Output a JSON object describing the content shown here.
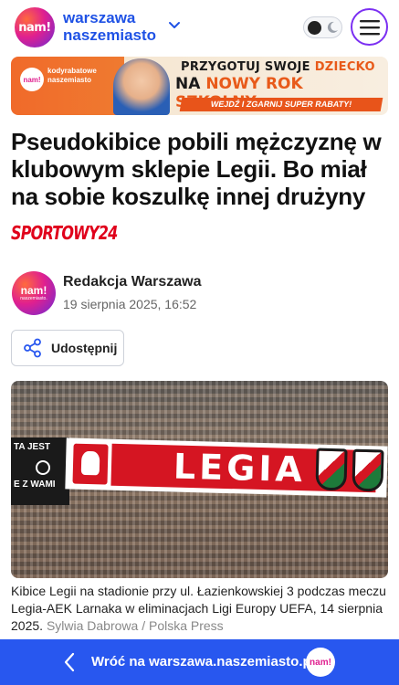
{
  "header": {
    "logo_text": "nam!",
    "brand_line1": "warszawa",
    "brand_line2": "naszemiasto",
    "icons": {
      "expand": "chevron-down-icon",
      "theme": "moon-icon",
      "menu": "hamburger-icon"
    },
    "accent_color": "#1f52e5"
  },
  "ad": {
    "badge": "nam!",
    "small_text_1": "kodyrabatowe",
    "small_text_2": "naszemiasto",
    "line1_a": "PRZYGOTUJ SWOJE ",
    "line1_b": "DZIECKO",
    "line2_a": "NA ",
    "line2_b": "NOWY ROK SZKOLNY",
    "line3": "WEJDŹ I ZGARNIJ SUPER RABATY!"
  },
  "article": {
    "title": "Pseudokibice pobili mężczyznę w klubowym sklepie Legii. Bo miał na sobie koszulkę innej drużyny",
    "source": "SPORTOWY24",
    "author_avatar_line1": "nam!",
    "author_avatar_line2": "naszemiasto.",
    "author": "Redakcja Warszawa",
    "date": "19 sierpnia 2025, 16:52",
    "share_label": "Udostępnij",
    "photo": {
      "banner_text": "LEGIA",
      "flag_text_1": "TA JEST",
      "flag_text_2": "E Z WAMI"
    },
    "caption": "Kibice Legii na stadionie przy ul. Łazienkowskiej 3 podczas meczu Legia-AEK Larnaka w eliminacjach Ligi Europy UEFA, 14 sierpnia 2025.",
    "credit": "Sylwia Dabrowa / Polska Press"
  },
  "bottom_bar": {
    "back_label": "Wróć na warszawa.naszemiasto.pl",
    "badge": "nam!",
    "color": "#2857ef"
  }
}
